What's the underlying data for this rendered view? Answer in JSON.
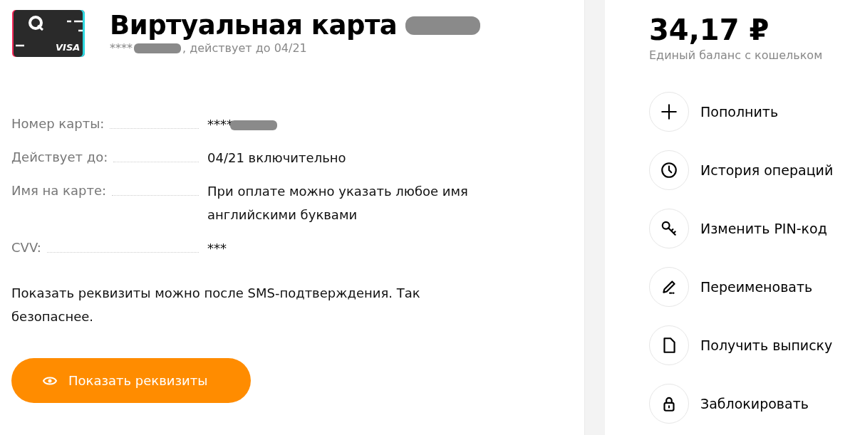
{
  "card": {
    "title": "Виртуальная карта",
    "subtitle_prefix": "****",
    "subtitle_suffix": ", действует до 04/21",
    "card_brand": "VISA"
  },
  "details": [
    {
      "label": "Номер карты:",
      "value": "****",
      "redacted": true
    },
    {
      "label": "Действует до:",
      "value": "04/21 включительно",
      "redacted": false
    },
    {
      "label": "Имя на карте:",
      "value": "При оплате можно указать любое имя английскими буквами",
      "redacted": false
    },
    {
      "label": "CVV:",
      "value": "***",
      "redacted": false
    }
  ],
  "note": "Показать реквизиты можно после SMS-подтверждения. Так безопаснее.",
  "show_button": {
    "label": "Показать реквизиты"
  },
  "balance": {
    "amount": "34,17 ₽",
    "caption": "Единый баланс с кошельком"
  },
  "actions": [
    {
      "kind": "plus",
      "label": "Пополнить"
    },
    {
      "kind": "clock",
      "label": "История операций"
    },
    {
      "kind": "key",
      "label": "Изменить PIN-код"
    },
    {
      "kind": "pencil",
      "label": "Переименовать"
    },
    {
      "kind": "file",
      "label": "Получить выписку"
    },
    {
      "kind": "lock",
      "label": "Заблокировать"
    }
  ]
}
